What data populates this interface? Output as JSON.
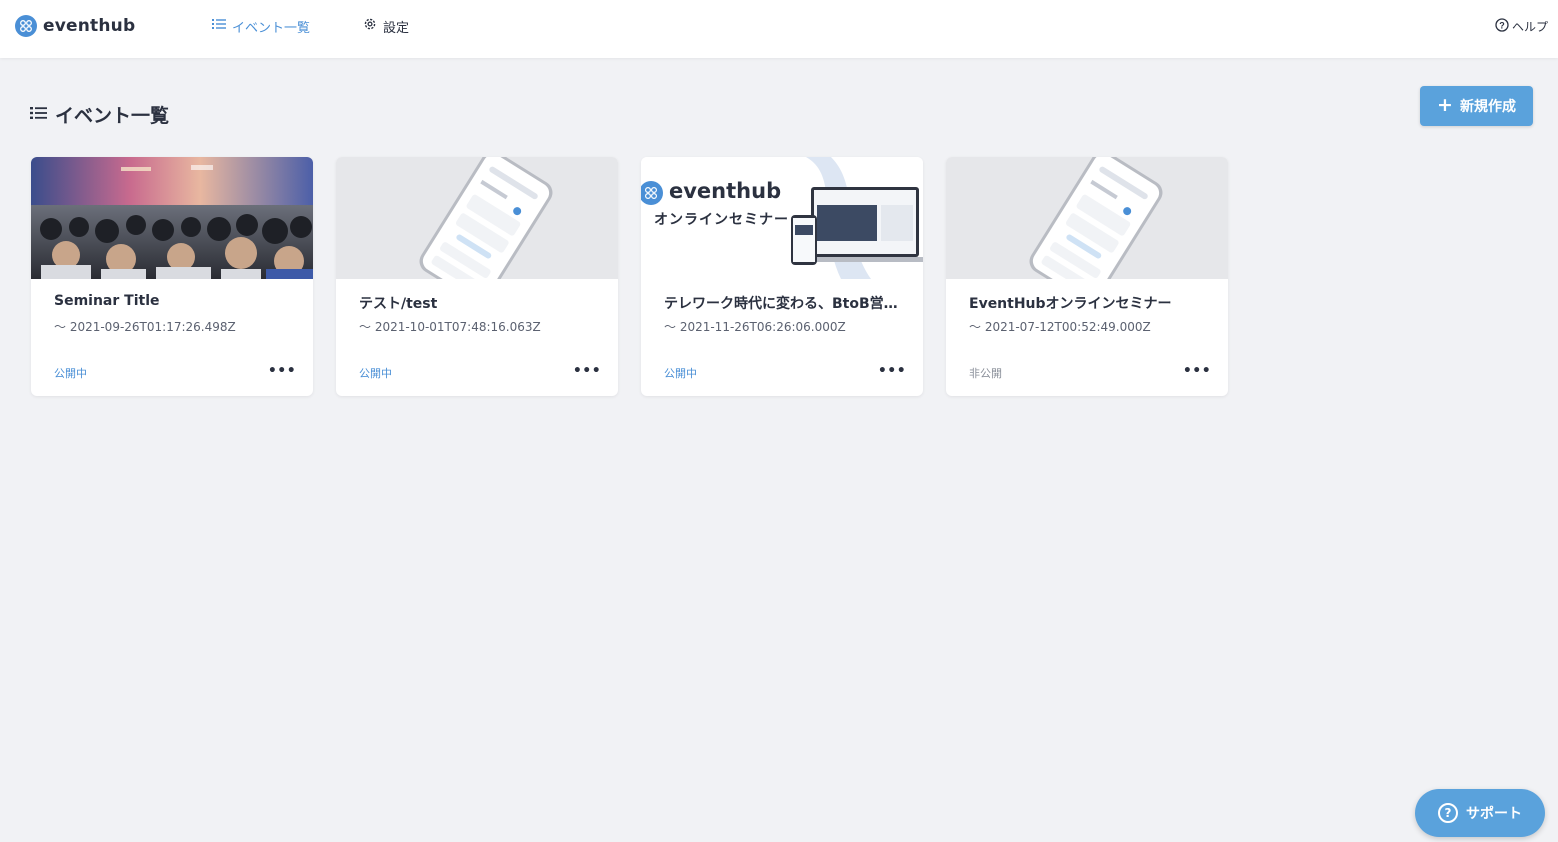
{
  "header": {
    "brand": "eventhub",
    "nav": {
      "events_label": "イベント一覧",
      "settings_label": "設定"
    },
    "help_label": "ヘルプ"
  },
  "page": {
    "title": "イベント一覧",
    "create_button_label": "新規作成"
  },
  "events": [
    {
      "title": "Seminar Title",
      "date": "〜 2021-09-26T01:17:26.498Z",
      "status": "公開中",
      "thumbnail": "seminar-audience-photo"
    },
    {
      "title": "テスト/test",
      "date": "〜 2021-10-01T07:48:16.063Z",
      "status": "公開中",
      "thumbnail": "phone-app-mockup"
    },
    {
      "title": "テレワーク時代に変わる、BtoB営…",
      "date": "〜 2021-11-26T06:26:06.000Z",
      "status": "公開中",
      "thumbnail": "eventhub-online-seminar-banner",
      "thumb_brand": "eventhub",
      "thumb_caption": "オンラインセミナー"
    },
    {
      "title": "EventHubオンラインセミナー",
      "date": "〜 2021-07-12T00:52:49.000Z",
      "status": "非公開",
      "thumbnail": "phone-app-mockup"
    }
  ],
  "more_glyph": "•••",
  "support_button_label": "サポート",
  "colors": {
    "accent": "#5aa2dc",
    "link": "#4a8fd6",
    "background": "#f1f2f5"
  }
}
